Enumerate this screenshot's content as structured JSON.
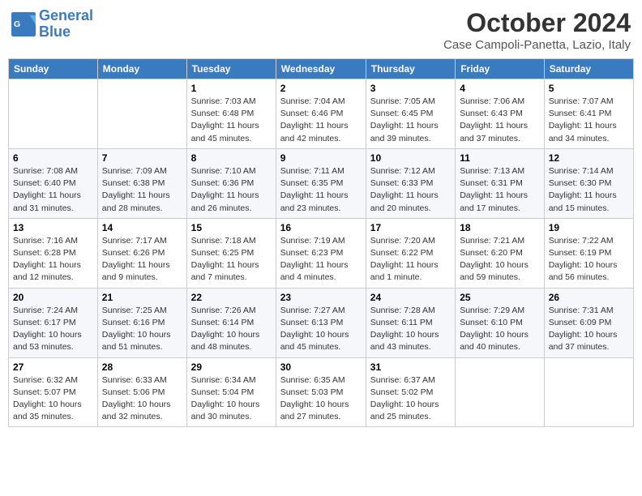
{
  "header": {
    "logo_line1": "General",
    "logo_line2": "Blue",
    "month": "October 2024",
    "location": "Case Campoli-Panetta, Lazio, Italy"
  },
  "days_of_week": [
    "Sunday",
    "Monday",
    "Tuesday",
    "Wednesday",
    "Thursday",
    "Friday",
    "Saturday"
  ],
  "weeks": [
    [
      {
        "day": "",
        "info": ""
      },
      {
        "day": "",
        "info": ""
      },
      {
        "day": "1",
        "info": "Sunrise: 7:03 AM\nSunset: 6:48 PM\nDaylight: 11 hours and 45 minutes."
      },
      {
        "day": "2",
        "info": "Sunrise: 7:04 AM\nSunset: 6:46 PM\nDaylight: 11 hours and 42 minutes."
      },
      {
        "day": "3",
        "info": "Sunrise: 7:05 AM\nSunset: 6:45 PM\nDaylight: 11 hours and 39 minutes."
      },
      {
        "day": "4",
        "info": "Sunrise: 7:06 AM\nSunset: 6:43 PM\nDaylight: 11 hours and 37 minutes."
      },
      {
        "day": "5",
        "info": "Sunrise: 7:07 AM\nSunset: 6:41 PM\nDaylight: 11 hours and 34 minutes."
      }
    ],
    [
      {
        "day": "6",
        "info": "Sunrise: 7:08 AM\nSunset: 6:40 PM\nDaylight: 11 hours and 31 minutes."
      },
      {
        "day": "7",
        "info": "Sunrise: 7:09 AM\nSunset: 6:38 PM\nDaylight: 11 hours and 28 minutes."
      },
      {
        "day": "8",
        "info": "Sunrise: 7:10 AM\nSunset: 6:36 PM\nDaylight: 11 hours and 26 minutes."
      },
      {
        "day": "9",
        "info": "Sunrise: 7:11 AM\nSunset: 6:35 PM\nDaylight: 11 hours and 23 minutes."
      },
      {
        "day": "10",
        "info": "Sunrise: 7:12 AM\nSunset: 6:33 PM\nDaylight: 11 hours and 20 minutes."
      },
      {
        "day": "11",
        "info": "Sunrise: 7:13 AM\nSunset: 6:31 PM\nDaylight: 11 hours and 17 minutes."
      },
      {
        "day": "12",
        "info": "Sunrise: 7:14 AM\nSunset: 6:30 PM\nDaylight: 11 hours and 15 minutes."
      }
    ],
    [
      {
        "day": "13",
        "info": "Sunrise: 7:16 AM\nSunset: 6:28 PM\nDaylight: 11 hours and 12 minutes."
      },
      {
        "day": "14",
        "info": "Sunrise: 7:17 AM\nSunset: 6:26 PM\nDaylight: 11 hours and 9 minutes."
      },
      {
        "day": "15",
        "info": "Sunrise: 7:18 AM\nSunset: 6:25 PM\nDaylight: 11 hours and 7 minutes."
      },
      {
        "day": "16",
        "info": "Sunrise: 7:19 AM\nSunset: 6:23 PM\nDaylight: 11 hours and 4 minutes."
      },
      {
        "day": "17",
        "info": "Sunrise: 7:20 AM\nSunset: 6:22 PM\nDaylight: 11 hours and 1 minute."
      },
      {
        "day": "18",
        "info": "Sunrise: 7:21 AM\nSunset: 6:20 PM\nDaylight: 10 hours and 59 minutes."
      },
      {
        "day": "19",
        "info": "Sunrise: 7:22 AM\nSunset: 6:19 PM\nDaylight: 10 hours and 56 minutes."
      }
    ],
    [
      {
        "day": "20",
        "info": "Sunrise: 7:24 AM\nSunset: 6:17 PM\nDaylight: 10 hours and 53 minutes."
      },
      {
        "day": "21",
        "info": "Sunrise: 7:25 AM\nSunset: 6:16 PM\nDaylight: 10 hours and 51 minutes."
      },
      {
        "day": "22",
        "info": "Sunrise: 7:26 AM\nSunset: 6:14 PM\nDaylight: 10 hours and 48 minutes."
      },
      {
        "day": "23",
        "info": "Sunrise: 7:27 AM\nSunset: 6:13 PM\nDaylight: 10 hours and 45 minutes."
      },
      {
        "day": "24",
        "info": "Sunrise: 7:28 AM\nSunset: 6:11 PM\nDaylight: 10 hours and 43 minutes."
      },
      {
        "day": "25",
        "info": "Sunrise: 7:29 AM\nSunset: 6:10 PM\nDaylight: 10 hours and 40 minutes."
      },
      {
        "day": "26",
        "info": "Sunrise: 7:31 AM\nSunset: 6:09 PM\nDaylight: 10 hours and 37 minutes."
      }
    ],
    [
      {
        "day": "27",
        "info": "Sunrise: 6:32 AM\nSunset: 5:07 PM\nDaylight: 10 hours and 35 minutes."
      },
      {
        "day": "28",
        "info": "Sunrise: 6:33 AM\nSunset: 5:06 PM\nDaylight: 10 hours and 32 minutes."
      },
      {
        "day": "29",
        "info": "Sunrise: 6:34 AM\nSunset: 5:04 PM\nDaylight: 10 hours and 30 minutes."
      },
      {
        "day": "30",
        "info": "Sunrise: 6:35 AM\nSunset: 5:03 PM\nDaylight: 10 hours and 27 minutes."
      },
      {
        "day": "31",
        "info": "Sunrise: 6:37 AM\nSunset: 5:02 PM\nDaylight: 10 hours and 25 minutes."
      },
      {
        "day": "",
        "info": ""
      },
      {
        "day": "",
        "info": ""
      }
    ]
  ]
}
